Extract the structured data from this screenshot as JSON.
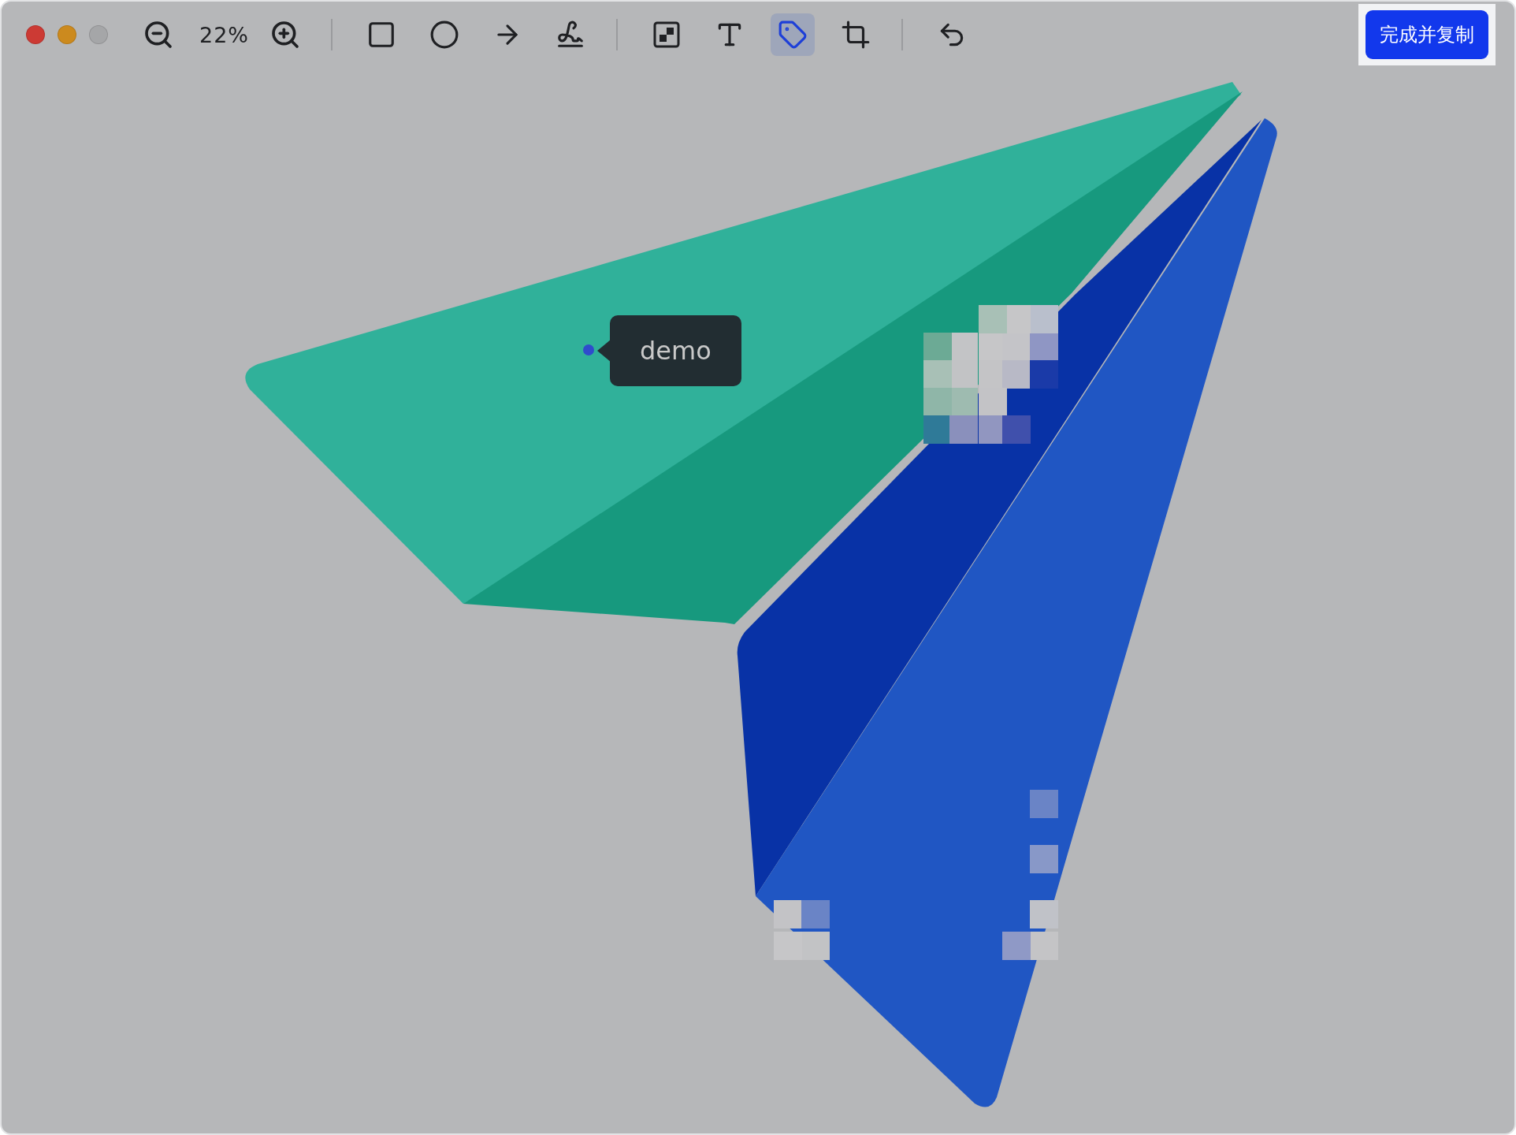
{
  "toolbar": {
    "zoom_level": "22%",
    "tools": [
      {
        "kind": "rectangle",
        "selected": false
      },
      {
        "kind": "ellipse",
        "selected": false
      },
      {
        "kind": "arrow",
        "selected": false
      },
      {
        "kind": "pen",
        "selected": false
      },
      {
        "kind": "mosaic",
        "selected": false
      },
      {
        "kind": "text",
        "selected": false
      },
      {
        "kind": "tag",
        "selected": true
      },
      {
        "kind": "crop",
        "selected": false
      }
    ],
    "finish_button": "完成并复制"
  },
  "canvas": {
    "tag": {
      "label": "demo"
    }
  }
}
